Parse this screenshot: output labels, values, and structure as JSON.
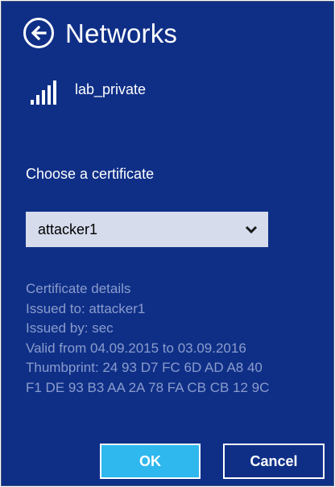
{
  "header": {
    "title": "Networks",
    "back_icon": "back-arrow-icon"
  },
  "network": {
    "name": "lab_private",
    "signal_icon": "wifi-signal-icon",
    "signal_level": "5/5"
  },
  "certificate": {
    "choose_label": "Choose a certificate",
    "selected": "attacker1",
    "dropdown_icon": "chevron-down-icon"
  },
  "details": {
    "heading": "Certificate details",
    "issued_to": "Issued to: attacker1",
    "issued_by": "Issued by: sec",
    "valid": "Valid from 04.09.2015 to 03.09.2016",
    "thumbprint_line1": "Thumbprint: 24 93 D7 FC 6D AD A8 40",
    "thumbprint_line2": "F1 DE 93 B3 AA 2A 78 FA CB CB 12 9C"
  },
  "buttons": {
    "ok_label": "OK",
    "cancel_label": "Cancel"
  },
  "colors": {
    "background": "#0f2f87",
    "accent": "#2fb8ee",
    "detail_text": "#8a9ccc",
    "dropdown_bg": "#d6dcec"
  }
}
